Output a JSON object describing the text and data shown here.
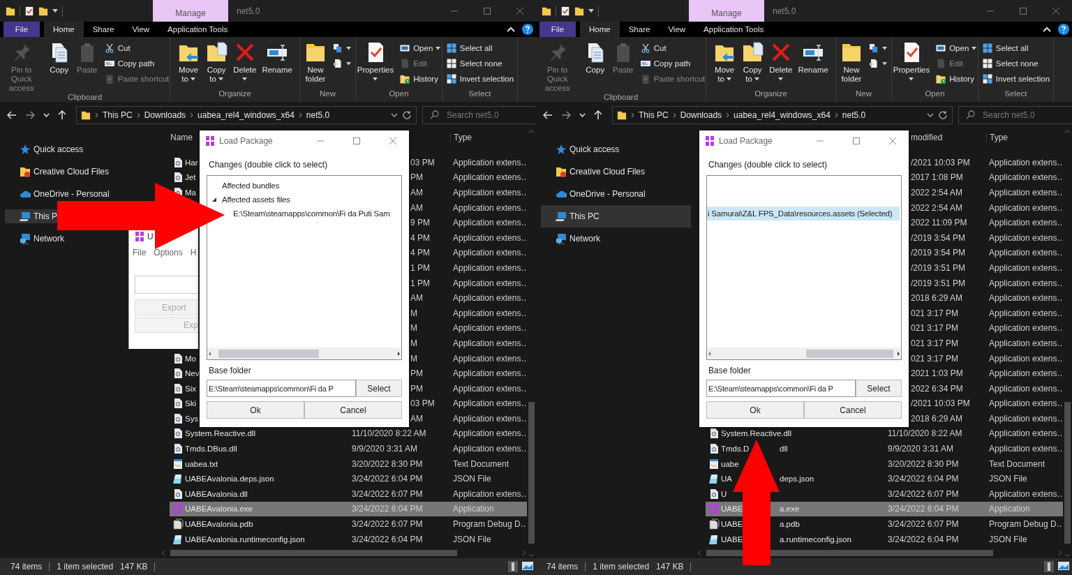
{
  "windows": [
    {
      "title": "net5.0",
      "context_tab": "Manage",
      "ribbon_tabs": [
        {
          "label": "File",
          "kind": "file",
          "selected": false
        },
        {
          "label": "Home",
          "kind": "tab",
          "selected": true
        },
        {
          "label": "Share",
          "kind": "tab",
          "selected": false
        },
        {
          "label": "View",
          "kind": "tab",
          "selected": false
        },
        {
          "label": "Application Tools",
          "kind": "tab",
          "selected": false
        }
      ],
      "ribbon_groups": [
        {
          "label": "Clipboard",
          "items": [
            {
              "kind": "pin",
              "label": "Pin to Quick access",
              "disabled": true,
              "dropdown": false
            },
            {
              "kind": "copy",
              "label": "Copy",
              "disabled": false,
              "dropdown": false
            },
            {
              "kind": "paste",
              "label": "Paste",
              "disabled": true,
              "dropdown": false
            },
            {
              "kind": "stack",
              "items": [
                {
                  "kind": "cut",
                  "label": "Cut",
                  "disabled": false,
                  "dropdown": false
                },
                {
                  "kind": "copy-path",
                  "label": "Copy path",
                  "disabled": false,
                  "dropdown": false
                },
                {
                  "kind": "paste-shortcut",
                  "label": "Paste shortcut",
                  "disabled": true,
                  "dropdown": false
                }
              ]
            }
          ]
        },
        {
          "label": "Organize",
          "items": [
            {
              "kind": "move",
              "label": "Move to",
              "disabled": false,
              "dropdown": true
            },
            {
              "kind": "copy-to",
              "label": "Copy to",
              "disabled": false,
              "dropdown": true
            },
            {
              "kind": "delete",
              "label": "Delete",
              "disabled": false,
              "dropdown": true
            },
            {
              "kind": "rename",
              "label": "Rename",
              "disabled": false,
              "dropdown": false
            }
          ]
        },
        {
          "label": "New",
          "items": [
            {
              "kind": "folder",
              "label": "New folder",
              "disabled": false,
              "dropdown": false
            },
            {
              "kind": "stack",
              "items": [
                {
                  "kind": "new-item",
                  "disabled": false,
                  "dropdown": true
                },
                {
                  "kind": "easy-access",
                  "disabled": false,
                  "dropdown": true
                }
              ]
            }
          ]
        },
        {
          "label": "Open",
          "items": [
            {
              "kind": "properties",
              "label": "Properties",
              "disabled": false,
              "dropdown": true
            },
            {
              "kind": "stack",
              "items": [
                {
                  "kind": "open",
                  "label": "Open",
                  "disabled": false,
                  "dropdown": true
                },
                {
                  "kind": "edit",
                  "label": "Edit",
                  "disabled": true,
                  "dropdown": false
                },
                {
                  "kind": "history",
                  "label": "History",
                  "disabled": false,
                  "dropdown": false
                }
              ]
            }
          ]
        },
        {
          "label": "Select",
          "items": [
            {
              "kind": "stack",
              "items": [
                {
                  "kind": "select-all",
                  "label": "Select all",
                  "disabled": false,
                  "dropdown": false
                },
                {
                  "kind": "select-none",
                  "label": "Select none",
                  "disabled": false,
                  "dropdown": false
                },
                {
                  "kind": "invert",
                  "label": "Invert selection",
                  "disabled": false,
                  "dropdown": false
                }
              ]
            }
          ]
        }
      ],
      "address": {
        "crumbs": [
          "This PC",
          "Downloads",
          "uabea_rel4_windows_x64",
          "net5.0"
        ],
        "search_placeholder": "Search net5.0"
      },
      "nav": [
        {
          "label": "Quick access",
          "kind": "star",
          "selected": false
        },
        {
          "label": "Creative Cloud Files",
          "kind": "cc",
          "selected": false
        },
        {
          "label": "OneDrive - Personal",
          "kind": "cloud",
          "selected": false
        },
        {
          "label": "This P",
          "kind": "pc",
          "selected": true
        },
        {
          "label": "Network",
          "kind": "network",
          "selected": false
        }
      ],
      "columns": [
        {
          "kind": "name",
          "label": "Name"
        },
        {
          "kind": "type",
          "label": "Type"
        }
      ],
      "files": [
        {
          "name": "Har",
          "kind": "dll",
          "date": "03 PM",
          "covered": true,
          "type": "Application extens…",
          "selected": false
        },
        {
          "name": "Jet",
          "kind": "dll",
          "date": "PM",
          "covered": true,
          "type": "Application extens…",
          "selected": false
        },
        {
          "name": "Ma",
          "kind": "dll",
          "date": "AM",
          "covered": true,
          "type": "Application extens…",
          "selected": false
        },
        {
          "date": "AM",
          "covered": true,
          "type": "Application extens…",
          "selected": false
        },
        {
          "date": "9 PM",
          "covered": true,
          "type": "Application extens…",
          "selected": false
        },
        {
          "date": "4 PM",
          "covered": true,
          "type": "Application extens…",
          "selected": false
        },
        {
          "date": "4 PM",
          "covered": true,
          "type": "Application extens…",
          "selected": false
        },
        {
          "date": "1 PM",
          "covered": true,
          "type": "Application extens…",
          "selected": false
        },
        {
          "date": "1 PM",
          "covered": true,
          "type": "Application extens…",
          "selected": false
        },
        {
          "date": "AM",
          "covered": true,
          "type": "Application extens…",
          "selected": false
        },
        {
          "date": "M",
          "covered": true,
          "type": "Application extens…",
          "selected": false
        },
        {
          "date": "M",
          "covered": true,
          "type": "Application extens…",
          "selected": false
        },
        {
          "date": "M",
          "covered": true,
          "type": "Application extens…",
          "selected": false
        },
        {
          "name": "Mo",
          "kind": "dll",
          "date": "M",
          "covered": true,
          "type": "Application extens…",
          "selected": false
        },
        {
          "name": "Nev",
          "kind": "dll",
          "date": "PM",
          "covered": true,
          "type": "Application extens…",
          "selected": false
        },
        {
          "name": "Six",
          "kind": "dll",
          "date": "PM",
          "covered": true,
          "type": "Application extens…",
          "selected": false
        },
        {
          "name": "Ski",
          "kind": "dll",
          "date": "03 PM",
          "covered": true,
          "type": "Application extens…",
          "selected": false
        },
        {
          "name": "Sys",
          "kind": "dll",
          "date": "AM",
          "covered": true,
          "type": "Application extens…",
          "selected": false
        },
        {
          "name": "System.Reactive.dll",
          "kind": "dll",
          "date": "11/10/2020 8:22 AM",
          "covered": false,
          "type": "Application extens…",
          "selected": false
        },
        {
          "name": "Tmds.DBus.dll",
          "kind": "dll",
          "date": "9/9/2020 3:31 AM",
          "covered": false,
          "type": "Application extens…",
          "selected": false
        },
        {
          "name": "uabea.txt",
          "kind": "txt",
          "date": "3/20/2022 8:30 PM",
          "covered": false,
          "type": "Text Document",
          "selected": false
        },
        {
          "name": "UABEAvalonia.deps.json",
          "kind": "json",
          "date": "3/24/2022 6:04 PM",
          "covered": false,
          "type": "JSON File",
          "selected": false
        },
        {
          "name": "UABEAvalonia.dll",
          "kind": "dll",
          "date": "3/24/2022 6:07 PM",
          "covered": false,
          "type": "Application extens…",
          "selected": false
        },
        {
          "name": "UABEAvalonia.exe",
          "kind": "exe",
          "date": "3/24/2022 6:04 PM",
          "covered": false,
          "type": "Application",
          "selected": true
        },
        {
          "name": "UABEAvalonia.pdb",
          "kind": "pdb",
          "date": "3/24/2022 6:07 PM",
          "covered": false,
          "type": "Program Debug D…",
          "selected": false
        },
        {
          "name": "UABEAvalonia.runtimeconfig.json",
          "kind": "json",
          "date": "3/24/2022 6:04 PM",
          "covered": false,
          "type": "JSON File",
          "selected": false
        }
      ],
      "status": {
        "count": "74 items",
        "selection": "1 item selected",
        "size": "147 KB"
      },
      "background_window": {
        "title": "U",
        "menu": [
          "File",
          "Options",
          "H"
        ],
        "buttons": [
          "Export",
          "Exp"
        ]
      },
      "dialog": {
        "title": "Load Package",
        "changes_label": "Changes (double click to select)",
        "tree": {
          "scrolled": false,
          "items": [
            {
              "kind": "node",
              "label": "Affected bundles",
              "expanded": false
            },
            {
              "kind": "node",
              "label": "Affected assets files",
              "expanded": true,
              "children": [
                {
                  "label": "E:\\Steam\\steamapps\\common\\Fi da Puti Sam",
                  "selected": false
                }
              ]
            }
          ]
        },
        "base_folder_label": "Base folder",
        "base_folder": "E:\\Steam\\steamapps\\common\\Fi da P",
        "select_button": "Select",
        "ok_button": "Ok",
        "cancel_button": "Cancel"
      },
      "arrow": {
        "kind": "right"
      }
    },
    {
      "title": "net5.0",
      "context_tab": "Manage",
      "ribbon_tabs": [
        {
          "label": "File",
          "kind": "file",
          "selected": false
        },
        {
          "label": "Home",
          "kind": "tab",
          "selected": true
        },
        {
          "label": "Share",
          "kind": "tab",
          "selected": false
        },
        {
          "label": "View",
          "kind": "tab",
          "selected": false
        },
        {
          "label": "Application Tools",
          "kind": "tab",
          "selected": false
        }
      ],
      "ribbon_groups": [
        {
          "label": "Clipboard",
          "items": [
            {
              "kind": "pin",
              "label": "Pin to Quick access",
              "disabled": true,
              "dropdown": false
            },
            {
              "kind": "copy",
              "label": "Copy",
              "disabled": false,
              "dropdown": false
            },
            {
              "kind": "paste",
              "label": "Paste",
              "disabled": true,
              "dropdown": false
            },
            {
              "kind": "stack",
              "items": [
                {
                  "kind": "cut",
                  "label": "Cut",
                  "disabled": false,
                  "dropdown": false
                },
                {
                  "kind": "copy-path",
                  "label": "Copy path",
                  "disabled": false,
                  "dropdown": false
                },
                {
                  "kind": "paste-shortcut",
                  "label": "Paste shortcut",
                  "disabled": true,
                  "dropdown": false
                }
              ]
            }
          ]
        },
        {
          "label": "Organize",
          "items": [
            {
              "kind": "move",
              "label": "Move to",
              "disabled": false,
              "dropdown": true
            },
            {
              "kind": "copy-to",
              "label": "Copy to",
              "disabled": false,
              "dropdown": true
            },
            {
              "kind": "delete",
              "label": "Delete",
              "disabled": false,
              "dropdown": true
            },
            {
              "kind": "rename",
              "label": "Rename",
              "disabled": false,
              "dropdown": false
            }
          ]
        },
        {
          "label": "New",
          "items": [
            {
              "kind": "folder",
              "label": "New folder",
              "disabled": false,
              "dropdown": false
            },
            {
              "kind": "stack",
              "items": [
                {
                  "kind": "new-item",
                  "disabled": false,
                  "dropdown": true
                },
                {
                  "kind": "easy-access",
                  "disabled": false,
                  "dropdown": true
                }
              ]
            }
          ]
        },
        {
          "label": "Open",
          "items": [
            {
              "kind": "properties",
              "label": "Properties",
              "disabled": false,
              "dropdown": true
            },
            {
              "kind": "stack",
              "items": [
                {
                  "kind": "open",
                  "label": "Open",
                  "disabled": false,
                  "dropdown": true
                },
                {
                  "kind": "edit",
                  "label": "Edit",
                  "disabled": true,
                  "dropdown": false
                },
                {
                  "kind": "history",
                  "label": "History",
                  "disabled": false,
                  "dropdown": false
                }
              ]
            }
          ]
        },
        {
          "label": "Select",
          "items": [
            {
              "kind": "stack",
              "items": [
                {
                  "kind": "select-all",
                  "label": "Select all",
                  "disabled": false,
                  "dropdown": false
                },
                {
                  "kind": "select-none",
                  "label": "Select none",
                  "disabled": false,
                  "dropdown": false
                },
                {
                  "kind": "invert",
                  "label": "Invert selection",
                  "disabled": false,
                  "dropdown": false
                }
              ]
            }
          ]
        }
      ],
      "address": {
        "crumbs": [
          "This PC",
          "Downloads",
          "uabea_rel4_windows_x64",
          "net5.0"
        ],
        "search_placeholder": "Search net5.0"
      },
      "nav": [
        {
          "label": "Quick access",
          "kind": "star",
          "selected": false
        },
        {
          "label": "Creative Cloud Files",
          "kind": "cc",
          "selected": false
        },
        {
          "label": "OneDrive - Personal",
          "kind": "cloud",
          "selected": false
        },
        {
          "label": "This PC",
          "kind": "pc",
          "selected": true
        },
        {
          "label": "Network",
          "kind": "network",
          "selected": false
        }
      ],
      "columns": [
        {
          "kind": "date",
          "label": "modified"
        },
        {
          "kind": "type",
          "label": "Type"
        }
      ],
      "files": [
        {
          "date": "/2021 10:03 PM",
          "covered": true,
          "type": "Application extens…",
          "selected": false
        },
        {
          "date": "2017 1:08 PM",
          "covered": true,
          "type": "Application extens…",
          "selected": false
        },
        {
          "date": "2022 2:54 AM",
          "covered": true,
          "type": "Application extens…",
          "selected": false
        },
        {
          "date": "2022 2:54 AM",
          "covered": true,
          "type": "Application extens…",
          "selected": false
        },
        {
          "date": "2022 11:09 PM",
          "covered": true,
          "type": "Application extens…",
          "selected": false
        },
        {
          "date": "/2019 3:54 PM",
          "covered": true,
          "type": "Application extens…",
          "selected": false
        },
        {
          "date": "/2019 3:54 PM",
          "covered": true,
          "type": "Application extens…",
          "selected": false
        },
        {
          "date": "/2019 3:51 PM",
          "covered": true,
          "type": "Application extens…",
          "selected": false
        },
        {
          "date": "/2019 3:51 PM",
          "covered": true,
          "type": "Application extens…",
          "selected": false
        },
        {
          "date": "2018 6:29 AM",
          "covered": true,
          "type": "Application extens…",
          "selected": false
        },
        {
          "date": "021 3:17 PM",
          "covered": true,
          "type": "Application extens…",
          "selected": false
        },
        {
          "date": "021 3:17 PM",
          "covered": true,
          "type": "Application extens…",
          "selected": false
        },
        {
          "date": "021 3:17 PM",
          "covered": true,
          "type": "Application extens…",
          "selected": false
        },
        {
          "date": "021 3:17 PM",
          "covered": true,
          "type": "Application extens…",
          "selected": false
        },
        {
          "date": "2021 1:03 PM",
          "covered": true,
          "type": "Application extens…",
          "selected": false
        },
        {
          "date": "2022 6:34 PM",
          "covered": true,
          "type": "Application extens…",
          "selected": false
        },
        {
          "date": "/2021 10:03 PM",
          "covered": true,
          "type": "Application extens…",
          "selected": false
        },
        {
          "date": "2018 6:29 AM",
          "covered": true,
          "type": "Application extens…",
          "selected": false
        },
        {
          "name": "System.Reactive.dll",
          "kind": "dll",
          "date": "11/10/2020 8:22 AM",
          "covered": false,
          "type": "Application extens…",
          "selected": false
        },
        {
          "name": "Tmds.D",
          "name_end": "dll",
          "kind": "dll",
          "date": "9/9/2020 3:31 AM",
          "covered": false,
          "type": "Application extens…",
          "selected": false
        },
        {
          "name": "uabe",
          "kind": "txt",
          "date": "3/20/2022 8:30 PM",
          "covered": false,
          "type": "Text Document",
          "selected": false
        },
        {
          "name": "UA",
          "name_end": "deps.json",
          "kind": "json",
          "date": "3/24/2022 6:04 PM",
          "covered": false,
          "type": "JSON File",
          "selected": false
        },
        {
          "name": "U",
          "kind": "dll",
          "date": "3/24/2022 6:07 PM",
          "covered": false,
          "type": "Application extens…",
          "selected": false
        },
        {
          "name": "UABE",
          "name_end": "a.exe",
          "kind": "exe",
          "date": "3/24/2022 6:04 PM",
          "covered": false,
          "type": "Application",
          "selected": true
        },
        {
          "name": "UABE",
          "name_end": "a.pdb",
          "kind": "pdb",
          "date": "3/24/2022 6:07 PM",
          "covered": false,
          "type": "Program Debug D…",
          "selected": false
        },
        {
          "name": "UABE",
          "name_end": "a.runtimeconfig.json",
          "kind": "json",
          "date": "3/24/2022 6:04 PM",
          "covered": false,
          "type": "JSON File",
          "selected": false
        }
      ],
      "status": {
        "count": "74 items",
        "selection": "1 item selected",
        "size": "147 KB"
      },
      "dialog": {
        "title": "Load Package",
        "changes_label": "Changes (double click to select)",
        "tree": {
          "scrolled": true,
          "items": [
            {
              "kind": "scrolled-out"
            },
            {
              "kind": "scrolled-out",
              "children": [
                {
                  "label": "i Samurai\\Z&L FPS_Data\\resources.assets (Selected)",
                  "selected": true
                }
              ]
            }
          ]
        },
        "base_folder_label": "Base folder",
        "base_folder": "E:\\Steam\\steamapps\\common\\Fi da P",
        "select_button": "Select",
        "ok_button": "Ok",
        "cancel_button": "Cancel"
      },
      "arrow": {
        "kind": "up"
      }
    }
  ]
}
